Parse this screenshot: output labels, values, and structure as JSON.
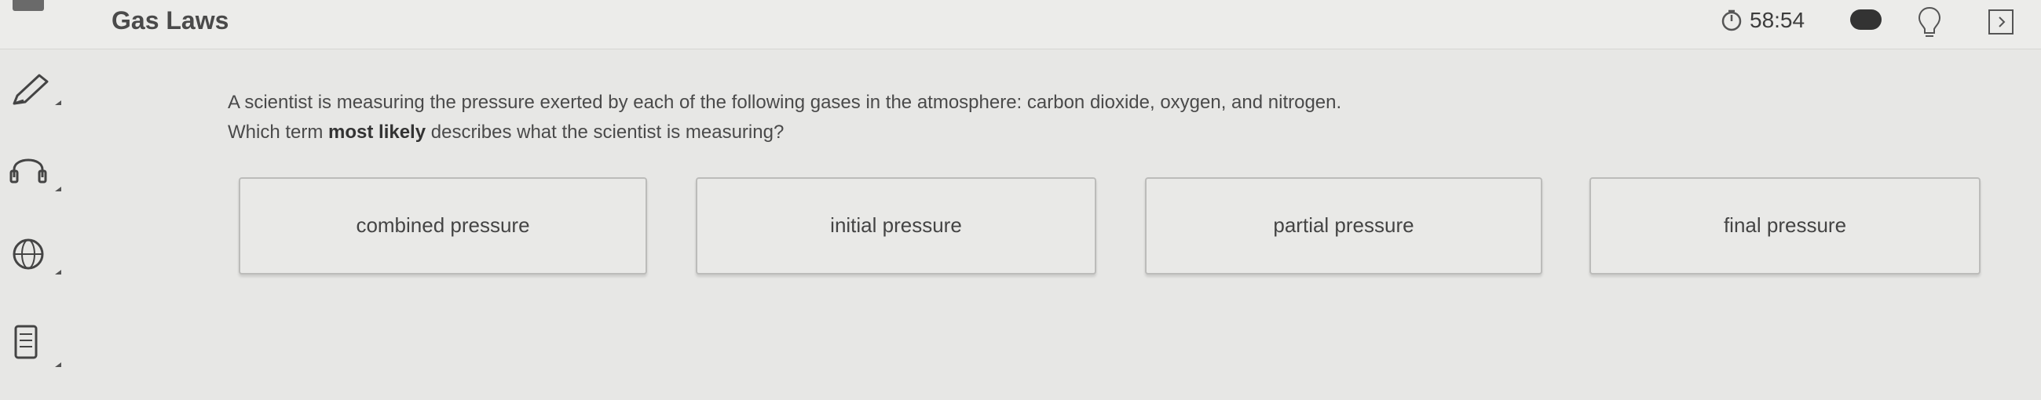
{
  "header": {
    "title": "Gas Laws",
    "timer": "58:54",
    "icons": [
      "menu-icon",
      "timer-icon",
      "progress-indicator",
      "lightbulb-icon",
      "expand-icon"
    ]
  },
  "sidebar": {
    "tools": [
      "pencil-icon",
      "headphones-icon",
      "translate-icon",
      "calculator-icon"
    ]
  },
  "question": {
    "text_before": "A scientist is measuring the pressure exerted by each of the following gases in the atmosphere: carbon dioxide, oxygen, and nitrogen. Which term ",
    "emphasis": "most likely",
    "text_after": " describes what the scientist is measuring?"
  },
  "choices": [
    {
      "label": "combined pressure"
    },
    {
      "label": "initial pressure"
    },
    {
      "label": "partial pressure"
    },
    {
      "label": "final pressure"
    }
  ]
}
